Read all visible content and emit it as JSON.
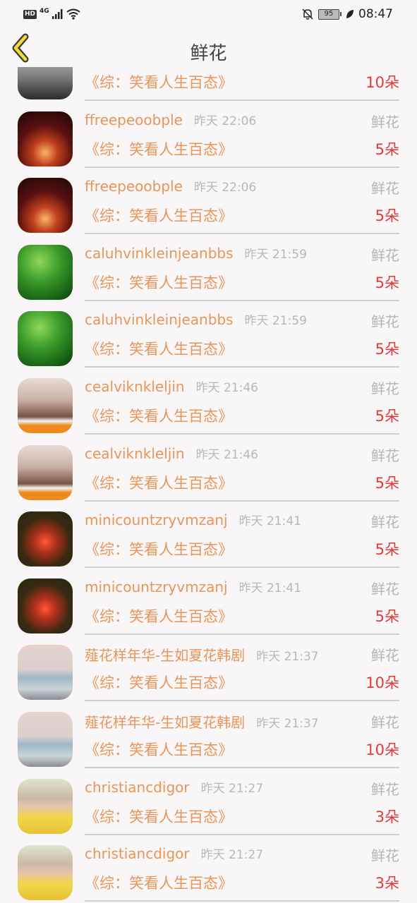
{
  "status_bar": {
    "network_badge": "HD",
    "network_type": "4G",
    "battery": "95",
    "time": "08:47"
  },
  "header": {
    "title": "鲜花"
  },
  "list": [
    {
      "avatar": "person-photo",
      "username": "",
      "time": "",
      "gift": "",
      "book": "《综：笑看人生百态》",
      "count": "10朵"
    },
    {
      "avatar": "temple-night",
      "username": "ffreepeoobple",
      "time": "昨天 22:06",
      "gift": "鲜花",
      "book": "《综：笑看人生百态》",
      "count": "5朵"
    },
    {
      "avatar": "temple-night",
      "username": "ffreepeoobple",
      "time": "昨天 22:06",
      "gift": "鲜花",
      "book": "《综：笑看人生百态》",
      "count": "5朵"
    },
    {
      "avatar": "lotus-bud",
      "username": "caluhvinkleinjeanbbs",
      "time": "昨天 21:59",
      "gift": "鲜花",
      "book": "《综：笑看人生百态》",
      "count": "5朵"
    },
    {
      "avatar": "lotus-bud",
      "username": "caluhvinkleinjeanbbs",
      "time": "昨天 21:59",
      "gift": "鲜花",
      "book": "《综：笑看人生百态》",
      "count": "5朵"
    },
    {
      "avatar": "girl-portrait",
      "username": "cealviknkleljin",
      "time": "昨天 21:46",
      "gift": "鲜花",
      "book": "《综：笑看人生百态》",
      "count": "5朵"
    },
    {
      "avatar": "girl-portrait",
      "username": "cealviknkleljin",
      "time": "昨天 21:46",
      "gift": "鲜花",
      "book": "《综：笑看人生百态》",
      "count": "5朵"
    },
    {
      "avatar": "sunset-lake",
      "username": "minicountzryvmzanj",
      "time": "昨天 21:41",
      "gift": "鲜花",
      "book": "《综：笑看人生百态》",
      "count": "5朵"
    },
    {
      "avatar": "sunset-lake",
      "username": "minicountzryvmzanj",
      "time": "昨天 21:41",
      "gift": "鲜花",
      "book": "《综：笑看人生百态》",
      "count": "5朵"
    },
    {
      "avatar": "sea-pier",
      "username": "薤花样年华-生如夏花韩剧",
      "time": "昨天 21:37",
      "gift": "鲜花",
      "book": "《综：笑看人生百态》",
      "count": "10朵"
    },
    {
      "avatar": "sea-pier",
      "username": "薤花样年华-生如夏花韩剧",
      "time": "昨天 21:37",
      "gift": "鲜花",
      "book": "《综：笑看人生百态》",
      "count": "10朵"
    },
    {
      "avatar": "child-yellow",
      "username": "christiancdigor",
      "time": "昨天 21:27",
      "gift": "鲜花",
      "book": "《综：笑看人生百态》",
      "count": "3朵"
    },
    {
      "avatar": "child-yellow",
      "username": "christiancdigor",
      "time": "昨天 21:27",
      "gift": "鲜花",
      "book": "《综：笑看人生百态》",
      "count": "3朵"
    }
  ]
}
